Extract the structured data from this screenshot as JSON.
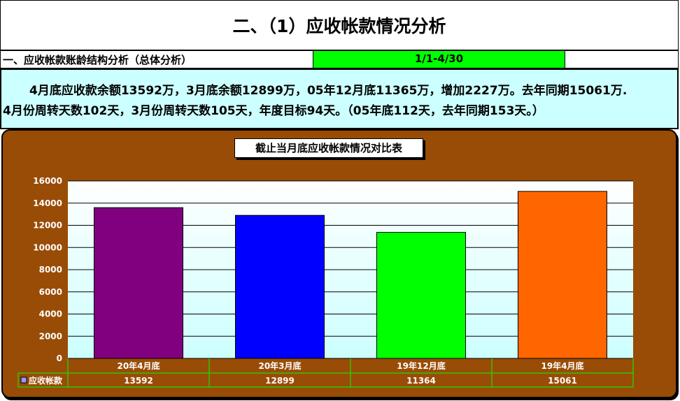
{
  "page_title": "二、（1）应收帐款情况分析",
  "section": {
    "label": "一、应收帐款账龄结构分析（总体分析）",
    "period": "1/1-4/30"
  },
  "summary": {
    "line1": "4月底应收款余额13592万，3月底余额12899万，05年12月底11365万，增加2227万。去年同期15061万.",
    "line2": "4月份周转天数102天，3月份周转天数105天，年度目标94天。（05年底112天，去年同期153天。）"
  },
  "chart_data": {
    "type": "bar",
    "title": "截止当月底应收帐款情况对比表",
    "categories": [
      "20年4月底",
      "20年3月底",
      "19年12月底",
      "19年4月底"
    ],
    "series": [
      {
        "name": "应收帐款",
        "values": [
          13592,
          12899,
          11364,
          15061
        ]
      }
    ],
    "bar_colors": [
      "#800080",
      "#0000FF",
      "#00FF00",
      "#FF6600"
    ],
    "legend_color": "#9999FF",
    "ylim": [
      0,
      16000
    ],
    "yticks": [
      0,
      2000,
      4000,
      6000,
      8000,
      10000,
      12000,
      14000,
      16000
    ],
    "grid": true,
    "legend_placement": "data-table",
    "xlabel": "",
    "ylabel": ""
  }
}
